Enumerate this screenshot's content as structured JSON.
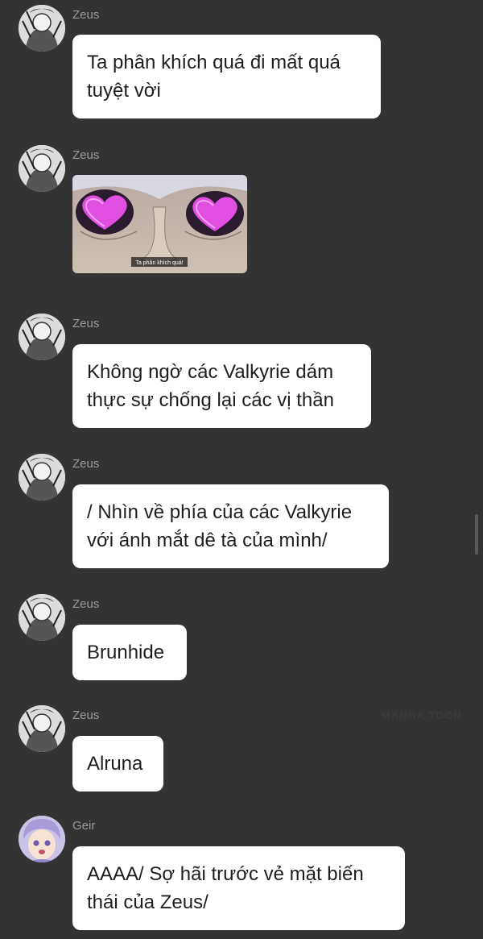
{
  "messages": [
    {
      "sender": "Zeus",
      "text": "Ta phân khích quá đi mất quá\ntuyệt vời"
    },
    {
      "sender": "Zeus",
      "image_caption": "Ta phân khích quá!"
    },
    {
      "sender": "Zeus",
      "text": "Không ngờ các Valkyrie dám\nthực sự chống lại các vị thần"
    },
    {
      "sender": "Zeus",
      "text": "/ Nhìn về phía của các Valkyrie\nvới ánh mắt dê tà của mình/"
    },
    {
      "sender": "Zeus",
      "text": "Brunhide"
    },
    {
      "sender": "Zeus",
      "text": "Alruna"
    },
    {
      "sender": "Geir",
      "text": "AAAA/ Sợ hãi trước vẻ mặt biến\nthái của Zeus/"
    }
  ],
  "watermark": "MANGA TOON",
  "colors": {
    "background": "#333333",
    "bubble": "#ffffff",
    "name": "#9a9a9a",
    "heart_eyes": "#e04fe0"
  }
}
